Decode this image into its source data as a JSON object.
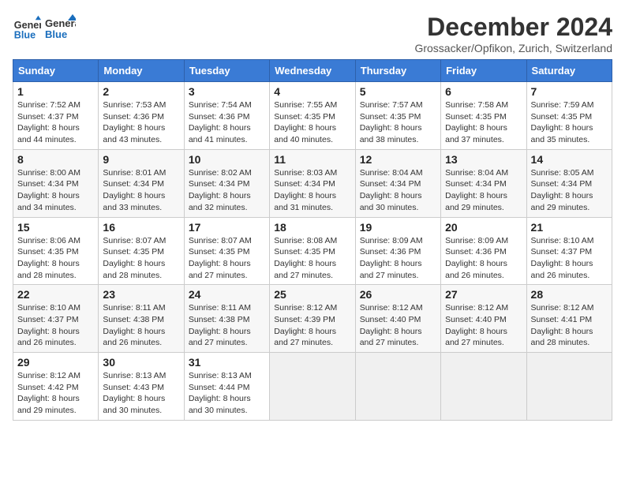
{
  "header": {
    "logo_line1": "General",
    "logo_line2": "Blue",
    "title": "December 2024",
    "subtitle": "Grossacker/Opfikon, Zurich, Switzerland"
  },
  "days_of_week": [
    "Sunday",
    "Monday",
    "Tuesday",
    "Wednesday",
    "Thursday",
    "Friday",
    "Saturday"
  ],
  "weeks": [
    [
      {
        "day": 1,
        "sunrise": "7:52 AM",
        "sunset": "4:37 PM",
        "daylight": "8 hours and 44 minutes."
      },
      {
        "day": 2,
        "sunrise": "7:53 AM",
        "sunset": "4:36 PM",
        "daylight": "8 hours and 43 minutes."
      },
      {
        "day": 3,
        "sunrise": "7:54 AM",
        "sunset": "4:36 PM",
        "daylight": "8 hours and 41 minutes."
      },
      {
        "day": 4,
        "sunrise": "7:55 AM",
        "sunset": "4:35 PM",
        "daylight": "8 hours and 40 minutes."
      },
      {
        "day": 5,
        "sunrise": "7:57 AM",
        "sunset": "4:35 PM",
        "daylight": "8 hours and 38 minutes."
      },
      {
        "day": 6,
        "sunrise": "7:58 AM",
        "sunset": "4:35 PM",
        "daylight": "8 hours and 37 minutes."
      },
      {
        "day": 7,
        "sunrise": "7:59 AM",
        "sunset": "4:35 PM",
        "daylight": "8 hours and 35 minutes."
      }
    ],
    [
      {
        "day": 8,
        "sunrise": "8:00 AM",
        "sunset": "4:34 PM",
        "daylight": "8 hours and 34 minutes."
      },
      {
        "day": 9,
        "sunrise": "8:01 AM",
        "sunset": "4:34 PM",
        "daylight": "8 hours and 33 minutes."
      },
      {
        "day": 10,
        "sunrise": "8:02 AM",
        "sunset": "4:34 PM",
        "daylight": "8 hours and 32 minutes."
      },
      {
        "day": 11,
        "sunrise": "8:03 AM",
        "sunset": "4:34 PM",
        "daylight": "8 hours and 31 minutes."
      },
      {
        "day": 12,
        "sunrise": "8:04 AM",
        "sunset": "4:34 PM",
        "daylight": "8 hours and 30 minutes."
      },
      {
        "day": 13,
        "sunrise": "8:04 AM",
        "sunset": "4:34 PM",
        "daylight": "8 hours and 29 minutes."
      },
      {
        "day": 14,
        "sunrise": "8:05 AM",
        "sunset": "4:34 PM",
        "daylight": "8 hours and 29 minutes."
      }
    ],
    [
      {
        "day": 15,
        "sunrise": "8:06 AM",
        "sunset": "4:35 PM",
        "daylight": "8 hours and 28 minutes."
      },
      {
        "day": 16,
        "sunrise": "8:07 AM",
        "sunset": "4:35 PM",
        "daylight": "8 hours and 28 minutes."
      },
      {
        "day": 17,
        "sunrise": "8:07 AM",
        "sunset": "4:35 PM",
        "daylight": "8 hours and 27 minutes."
      },
      {
        "day": 18,
        "sunrise": "8:08 AM",
        "sunset": "4:35 PM",
        "daylight": "8 hours and 27 minutes."
      },
      {
        "day": 19,
        "sunrise": "8:09 AM",
        "sunset": "4:36 PM",
        "daylight": "8 hours and 27 minutes."
      },
      {
        "day": 20,
        "sunrise": "8:09 AM",
        "sunset": "4:36 PM",
        "daylight": "8 hours and 26 minutes."
      },
      {
        "day": 21,
        "sunrise": "8:10 AM",
        "sunset": "4:37 PM",
        "daylight": "8 hours and 26 minutes."
      }
    ],
    [
      {
        "day": 22,
        "sunrise": "8:10 AM",
        "sunset": "4:37 PM",
        "daylight": "8 hours and 26 minutes."
      },
      {
        "day": 23,
        "sunrise": "8:11 AM",
        "sunset": "4:38 PM",
        "daylight": "8 hours and 26 minutes."
      },
      {
        "day": 24,
        "sunrise": "8:11 AM",
        "sunset": "4:38 PM",
        "daylight": "8 hours and 27 minutes."
      },
      {
        "day": 25,
        "sunrise": "8:12 AM",
        "sunset": "4:39 PM",
        "daylight": "8 hours and 27 minutes."
      },
      {
        "day": 26,
        "sunrise": "8:12 AM",
        "sunset": "4:40 PM",
        "daylight": "8 hours and 27 minutes."
      },
      {
        "day": 27,
        "sunrise": "8:12 AM",
        "sunset": "4:40 PM",
        "daylight": "8 hours and 27 minutes."
      },
      {
        "day": 28,
        "sunrise": "8:12 AM",
        "sunset": "4:41 PM",
        "daylight": "8 hours and 28 minutes."
      }
    ],
    [
      {
        "day": 29,
        "sunrise": "8:12 AM",
        "sunset": "4:42 PM",
        "daylight": "8 hours and 29 minutes."
      },
      {
        "day": 30,
        "sunrise": "8:13 AM",
        "sunset": "4:43 PM",
        "daylight": "8 hours and 30 minutes."
      },
      {
        "day": 31,
        "sunrise": "8:13 AM",
        "sunset": "4:44 PM",
        "daylight": "8 hours and 30 minutes."
      },
      null,
      null,
      null,
      null
    ]
  ]
}
